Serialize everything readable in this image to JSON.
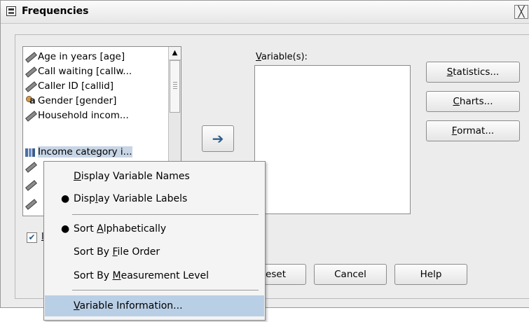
{
  "window": {
    "title": "Frequencies",
    "close_glyph": "╳"
  },
  "source_list": {
    "items": [
      {
        "label": "Age in years [age]",
        "icon": "scale-ruler-icon"
      },
      {
        "label": "Call waiting [callw...",
        "icon": "scale-ruler-icon"
      },
      {
        "label": "Caller ID [callid]",
        "icon": "scale-ruler-icon"
      },
      {
        "label": "Gender [gender]",
        "icon": "nominal-icon"
      },
      {
        "label": "Household incom...",
        "icon": "scale-ruler-icon"
      },
      {
        "label": "Income category i...",
        "icon": "ordinal-bars-icon",
        "selected": true
      },
      {
        "label": "",
        "icon": "scale-ruler-icon"
      },
      {
        "label": "",
        "icon": "scale-ruler-icon"
      },
      {
        "label": "",
        "icon": "scale-ruler-icon"
      }
    ],
    "scroll_up_glyph": "▲"
  },
  "move_button": {
    "glyph": "➔"
  },
  "target": {
    "label_prefix": "",
    "label_accel": "V",
    "label_rest": "ariable(s):"
  },
  "side_buttons": [
    {
      "accel": "S",
      "rest": "tatistics..."
    },
    {
      "accel": "C",
      "rest": "harts..."
    },
    {
      "accel": "F",
      "rest": "ormat..."
    }
  ],
  "checkbox": {
    "checked": true,
    "check_glyph": "✔",
    "visible_label": "l"
  },
  "bottom_buttons": {
    "reset_partial": "eset",
    "cancel": "Cancel",
    "help": "Help"
  },
  "context_menu": {
    "items": [
      {
        "pre": "",
        "accel": "D",
        "post": "isplay Variable Names",
        "bullet": ""
      },
      {
        "pre": "Disp",
        "accel": "l",
        "post": "ay Variable Labels",
        "bullet": "●"
      },
      {
        "pre": "Sort ",
        "accel": "A",
        "post": "lphabetically",
        "bullet": "●"
      },
      {
        "pre": "Sort By ",
        "accel": "F",
        "post": "ile Order",
        "bullet": ""
      },
      {
        "pre": "Sort By ",
        "accel": "M",
        "post": "easurement Level",
        "bullet": ""
      },
      {
        "pre": "",
        "accel": "V",
        "post": "ariable Information...",
        "bullet": ""
      }
    ]
  },
  "ghost_text": "r"
}
